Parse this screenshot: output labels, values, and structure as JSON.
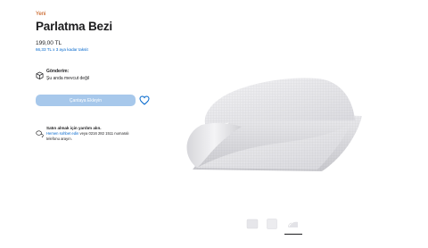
{
  "product": {
    "badge": "Yeni",
    "title": "Parlatma Bezi",
    "price": "199,00 TL",
    "installment": "66,33 TL x 3 aya kadar taksit"
  },
  "shipping": {
    "icon": "box-icon",
    "title": "Gönderim:",
    "status": "Şu anda mevcut değil"
  },
  "actions": {
    "add_to_bag_label": "Çantaya Ekleyin",
    "favorite_icon": "heart-icon"
  },
  "help": {
    "icon": "chat-icon",
    "title": "Satın almak için yardım alın.",
    "link_text": "Hemen sohbet edin",
    "after_link": " veya 0216 282 1511 numaralı",
    "line3": "telefonu arayın."
  },
  "gallery": {
    "thumbnails": [
      "cloth-flat-thumbnail",
      "cloth-flat-thumbnail",
      "cloth-folded-thumbnail"
    ],
    "selected_index": 2
  },
  "colors": {
    "accent_orange": "#bf4800",
    "link_blue": "#0066cc",
    "button_disabled_blue": "#a7c8eb",
    "text": "#1d1d1f"
  }
}
